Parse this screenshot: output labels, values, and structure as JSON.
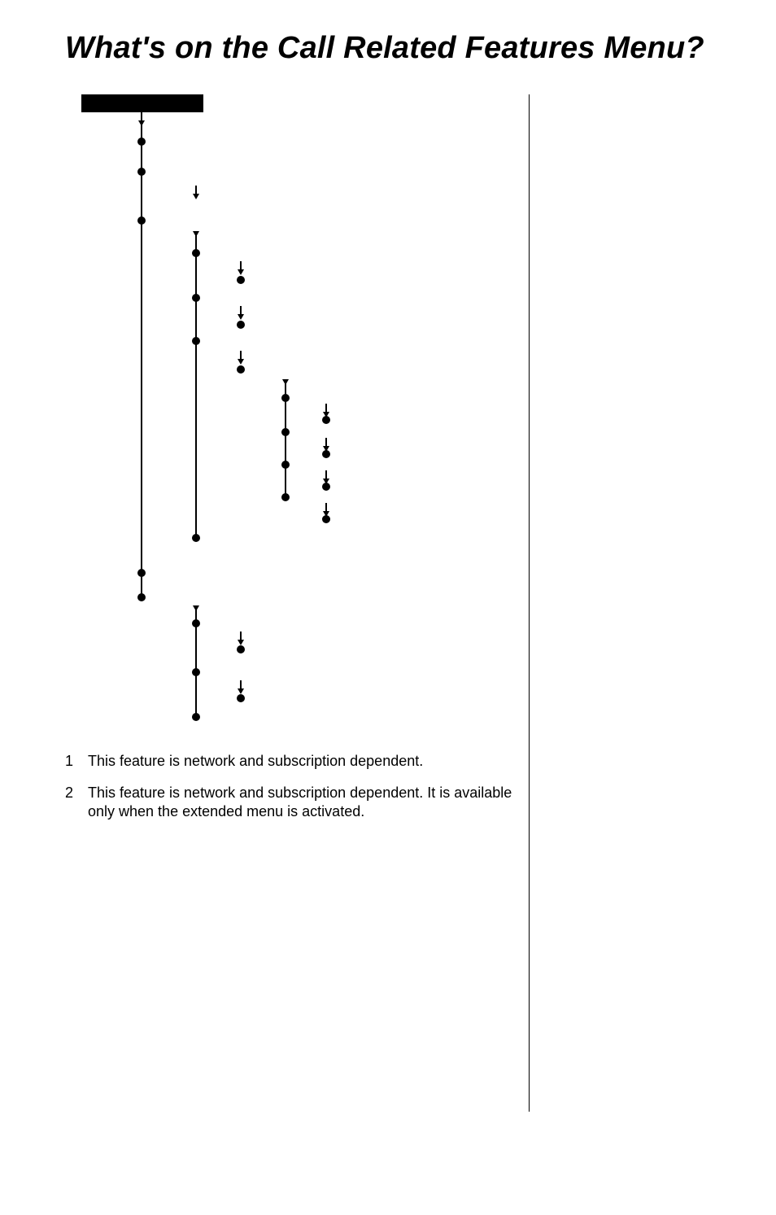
{
  "title": "What's on the Call Related Features Menu?",
  "footnotes": [
    {
      "num": "1",
      "text": "This feature is network and subscription dependent."
    },
    {
      "num": "2",
      "text": "This feature is network and subscription dependent. It is available only when the extended menu is activated."
    }
  ]
}
